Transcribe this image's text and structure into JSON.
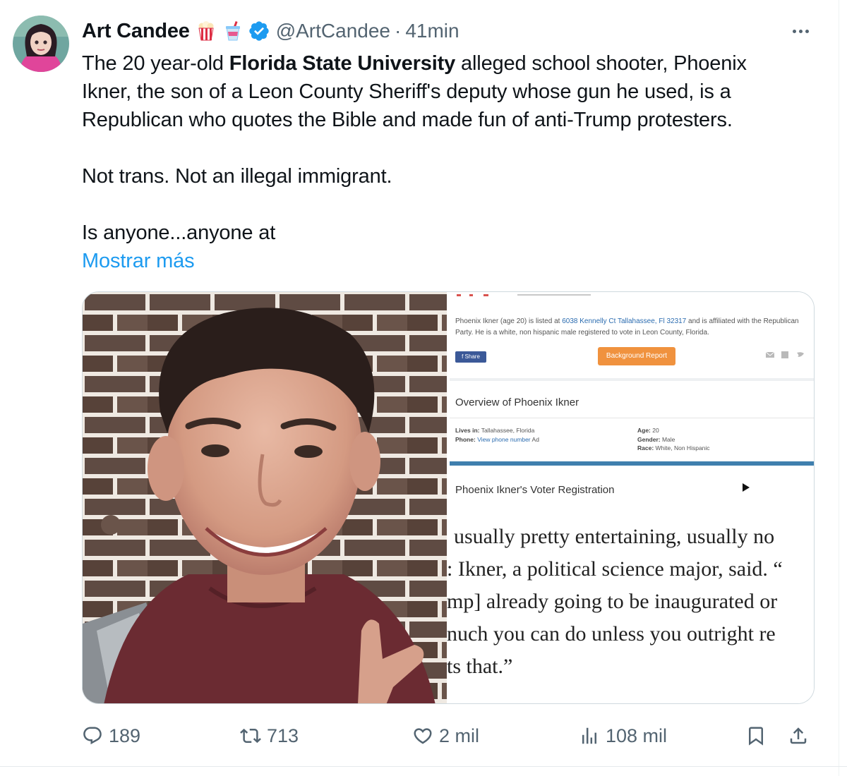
{
  "author": {
    "display_name": "Art Candee",
    "emojis": [
      "popcorn-emoji",
      "cup-with-straw-emoji"
    ],
    "verified": true,
    "handle": "@ArtCandee",
    "separator": "·",
    "timestamp": "41min"
  },
  "tweet": {
    "line1_a": "The 20 year-old ",
    "line1_bold": "Florida State University",
    "line1_b": " alleged school shooter, Phoenix",
    "line2": "Ikner, the son of a Leon County Sheriff's deputy whose gun he used, is a",
    "line3": "Republican who quotes the Bible and made fun of anti-Trump protesters.",
    "line4": "Not trans. Not an illegal immigrant.",
    "line5": "Is anyone...anyone at",
    "show_more": "Mostrar más"
  },
  "media_doc": {
    "intro_a": "Phoenix Ikner (age 20) is listed at ",
    "intro_link": "6038 Kennelly Ct Tallahassee, Fl 32317",
    "intro_b": " and is affiliated with the Republican Party. He is a white, non hispanic male registered to vote in Leon County, Florida.",
    "share_label": "f  Share",
    "background_report": "Background Report",
    "overview_title": "Overview of Phoenix Ikner",
    "lives_in_label": "Lives in:",
    "lives_in_value": "Tallahassee, Florida",
    "phone_label": "Phone:",
    "phone_value": "View phone number",
    "phone_ad": "Ad",
    "age_label": "Age:",
    "age_value": "20",
    "gender_label": "Gender:",
    "gender_value": "Male",
    "race_label": "Race:",
    "race_value": "White, Non Hispanic",
    "voter_title": "Phoenix Ikner's Voter Registration",
    "quote_lines": [
      "usually pretty entertaining, usually no",
      ": Ikner, a political science major, said. “",
      "mp] already going to be inaugurated or",
      "nuch you can do unless you outright re",
      "ts that.”"
    ]
  },
  "actions": {
    "replies": "189",
    "reposts": "713",
    "likes": "2 mil",
    "views": "108 mil"
  },
  "colors": {
    "link": "#1d9bf0",
    "muted": "#536471",
    "verified": "#1d9bf0"
  }
}
